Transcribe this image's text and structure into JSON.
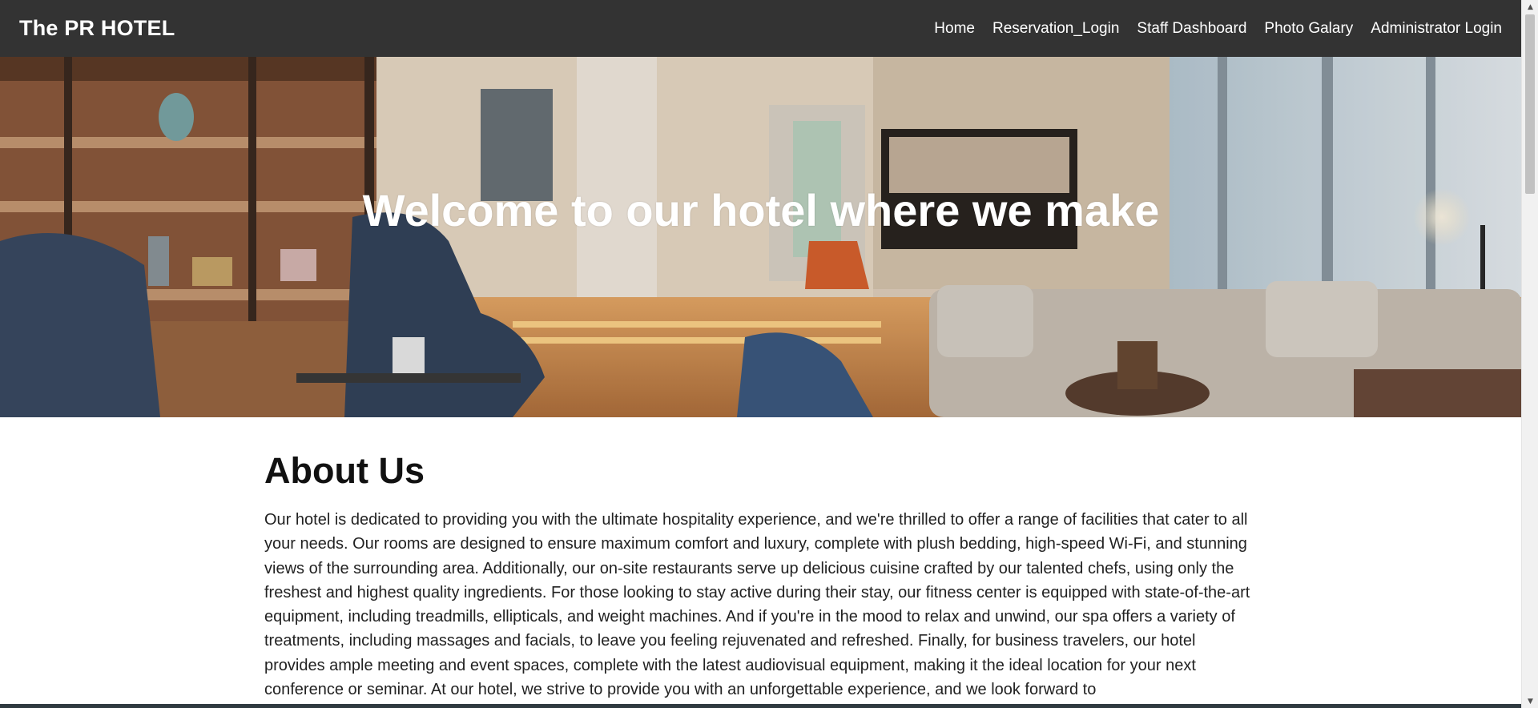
{
  "brand": {
    "name": "The PR HOTEL"
  },
  "nav": {
    "items": [
      {
        "label": "Home"
      },
      {
        "label": "Reservation_Login"
      },
      {
        "label": "Staff Dashboard"
      },
      {
        "label": "Photo Galary"
      },
      {
        "label": "Administrator Login"
      }
    ]
  },
  "hero": {
    "title": "Welcome to our hotel where we make"
  },
  "about": {
    "heading": "About Us",
    "text": "Our hotel is dedicated to providing you with the ultimate hospitality experience, and we're thrilled to offer a range of facilities that cater to all your needs. Our rooms are designed to ensure maximum comfort and luxury, complete with plush bedding, high-speed Wi-Fi, and stunning views of the surrounding area. Additionally, our on-site restaurants serve up delicious cuisine crafted by our talented chefs, using only the freshest and highest quality ingredients. For those looking to stay active during their stay, our fitness center is equipped with state-of-the-art equipment, including treadmills, ellipticals, and weight machines. And if you're in the mood to relax and unwind, our spa offers a variety of treatments, including massages and facials, to leave you feeling rejuvenated and refreshed. Finally, for business travelers, our hotel provides ample meeting and event spaces, complete with the latest audiovisual equipment, making it the ideal location for your next conference or seminar. At our hotel, we strive to provide you with an unforgettable experience, and we look forward to"
  },
  "colors": {
    "navbar_bg": "#333333",
    "nav_text": "#ffffff",
    "page_bg": "#ffffff",
    "heading_text": "#111111"
  },
  "icons": {
    "scroll_up": "▲",
    "scroll_down": "▼"
  }
}
